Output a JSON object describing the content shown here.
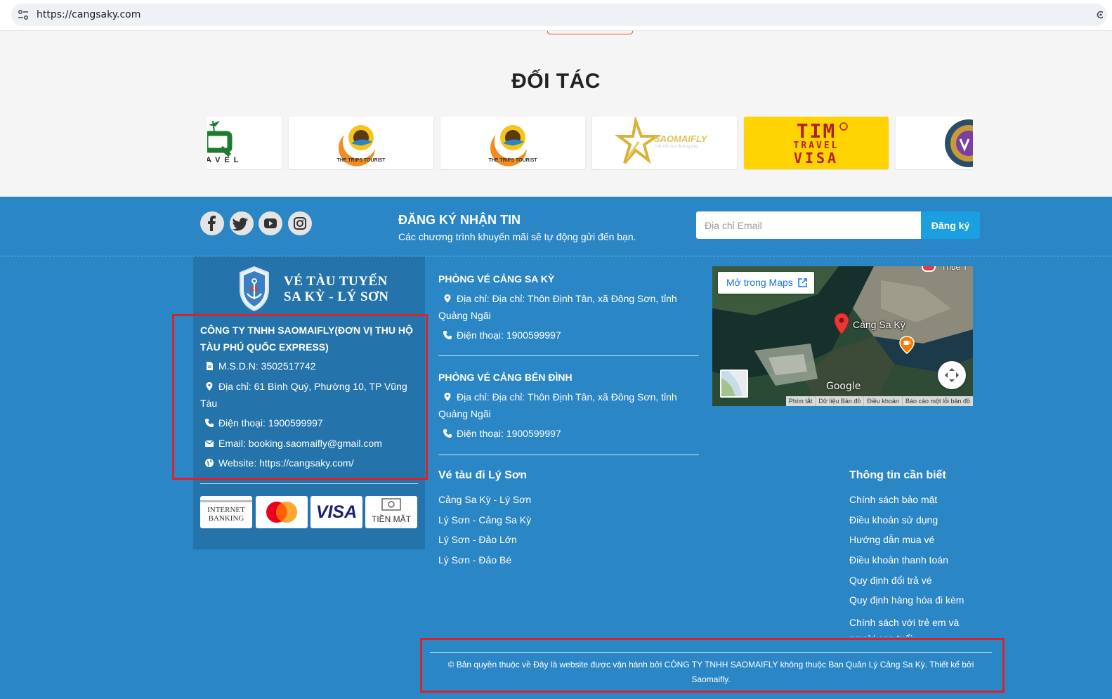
{
  "browser": {
    "url": "https://cangsaky.com"
  },
  "partners": {
    "title": "ĐỐI TÁC",
    "logos": [
      {
        "name": "partial-travel-logo",
        "text": "AVEL"
      },
      {
        "name": "the-trips-tourist-logo-1",
        "text": "THE TRIPS TOURIST"
      },
      {
        "name": "the-trips-tourist-logo-2",
        "text": "THE TRIPS TOURIST"
      },
      {
        "name": "saomaifly-logo",
        "text": "SAOMAIFLY",
        "tagline": "Kết nối mọi đường bay"
      },
      {
        "name": "tim-travel-visa-logo",
        "text1": "TIM",
        "text2": "TRAVEL",
        "text3": "VISA"
      },
      {
        "name": "partial-round-seal-logo",
        "text": ""
      }
    ],
    "colors": {
      "bg": "#f5f5f5",
      "tim_yellow": "#ffd400",
      "trips_orange": "#f28c1e"
    }
  },
  "newsletter": {
    "title": "ĐĂNG KÝ NHẬN TIN",
    "subtitle": "Các chương trình khuyến mãi sẽ tự động gửi đến bạn.",
    "email_placeholder": "Địa chỉ Email",
    "button_label": "Đăng ký"
  },
  "social": [
    "facebook-icon",
    "twitter-icon",
    "youtube-icon",
    "instagram-icon"
  ],
  "company": {
    "brand_line1": "VÉ TÀU TUYẾN",
    "brand_line2": "SA KỲ - LÝ SƠN",
    "name": "CÔNG TY TNHH SAOMAIFLY(ĐƠN VỊ THU HỘ TÀU PHÚ QUỐC EXPRESS)",
    "tax_id": "M.S.D.N: 3502517742",
    "address": "Địa chỉ: 61 Bình Quý, Phường 10, TP Vũng Tàu",
    "phone": "Điện thoại: 1900599997",
    "email": "Email: booking.saomaifly@gmail.com",
    "website": "Website: https://cangsaky.com/"
  },
  "payments": {
    "internet_banking_line1": "INTERNET",
    "internet_banking_line2": "BANKING",
    "visa": "VISA",
    "cash": "TIỀN MẶT"
  },
  "offices": [
    {
      "title": "PHÒNG VÉ CẢNG SA KỲ",
      "address": "Địa chỉ: Địa chỉ: Thôn Định Tân, xã Đông Sơn, tỉnh Quảng Ngãi",
      "phone": "Điện thoại: 1900599997"
    },
    {
      "title": "PHÒNG VÉ CẢNG BẾN ĐÌNH",
      "address": "Địa chỉ: Địa chỉ: Thôn Định Tân, xã Đông Sơn, tỉnh Quảng Ngãi",
      "phone": "Điện thoại: 1900599997"
    }
  ],
  "map": {
    "open_label": "Mở trong Maps",
    "place_label": "Cảng Sa Kỳ",
    "top_label": "Thuế T",
    "google": "Google",
    "attribution": [
      "Phím tắt",
      "Dữ liệu Bản đồ",
      "Điều khoản",
      "Báo cáo một lỗi bản đồ"
    ]
  },
  "routes": {
    "title": "Vé tàu đi Lý Sơn",
    "links": [
      "Cảng Sa Kỳ - Lý Sơn",
      "Lý Sơn - Cảng Sa Kỳ",
      "Lý Sơn - Đảo Lớn",
      "Lý Sơn - Đảo Bé"
    ]
  },
  "info": {
    "title": "Thông tin cần biết",
    "links": [
      "Chính sách bảo mật",
      "Điều khoản sử dụng",
      "Hướng dẫn mua vé",
      "Điều khoản thanh toán",
      "Quy định đổi trả vé",
      "Quy định hàng hóa đi kèm"
    ],
    "last_link": "Chính sách với trẻ em và người cao tuổi"
  },
  "copyright": "© Bản quyền thuộc về Đây là website được vận hành bởi CÔNG TY TNHH SAOMAIFLY không thuộc Ban Quản Lý Cảng Sa Kỳ.  Thiết kế bởi Saomaifly.",
  "colors": {
    "footer_bg": "#2b86c5",
    "company_box": "#2573ab",
    "highlight_red": "#d9222a",
    "subscribe_btn": "#1a9fe0"
  }
}
